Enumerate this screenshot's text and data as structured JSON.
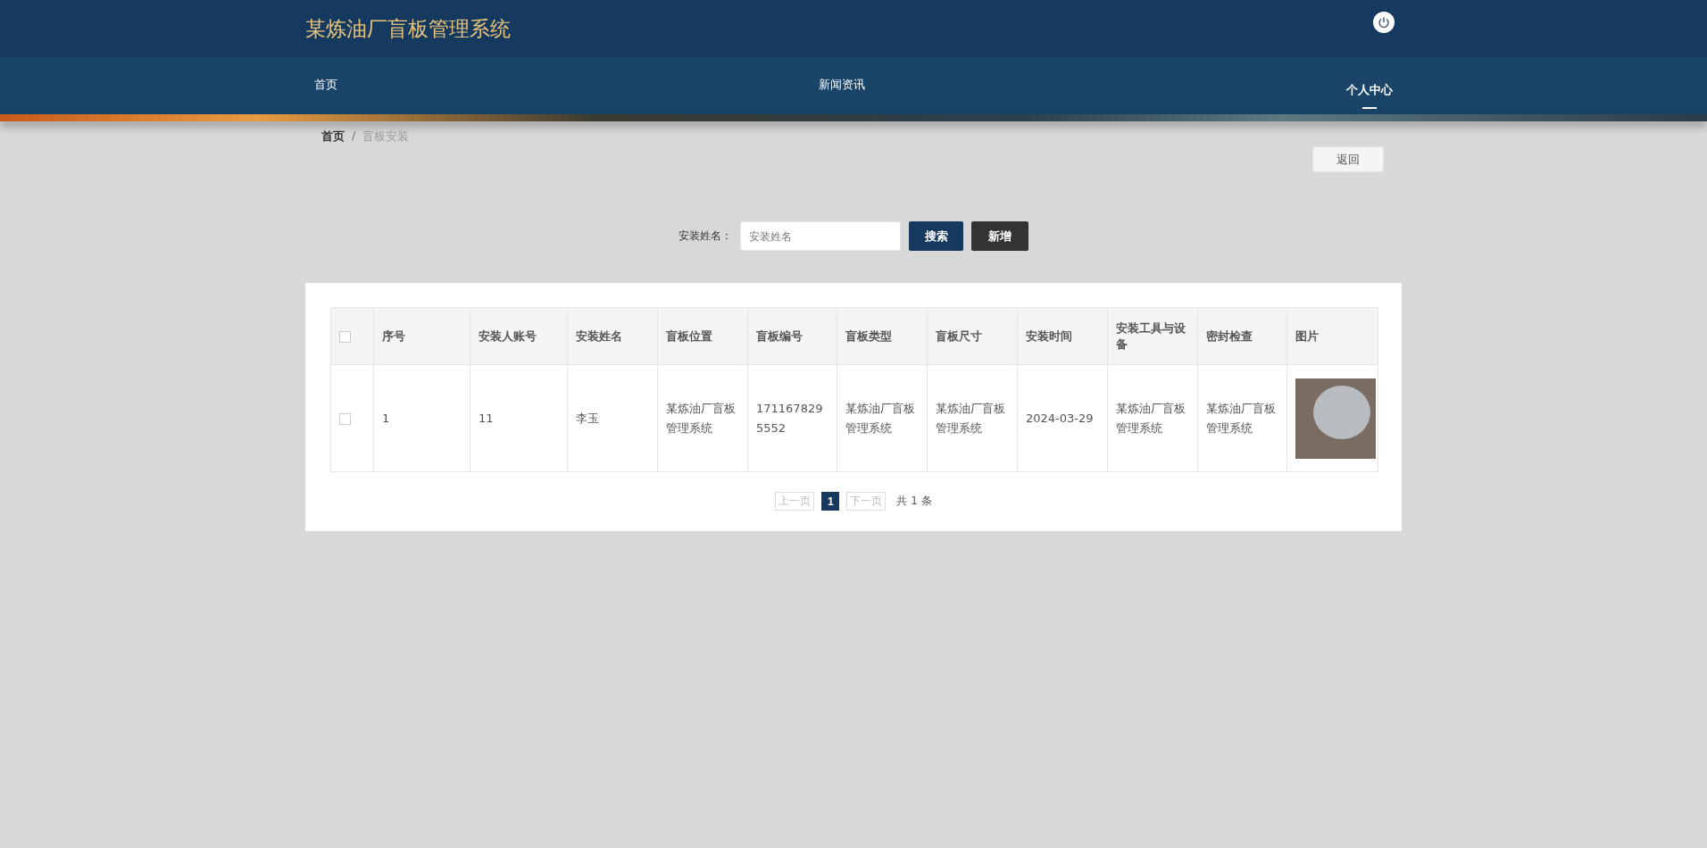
{
  "header": {
    "title": "某炼油厂盲板管理系统"
  },
  "nav": [
    {
      "label": "首页",
      "selected": false
    },
    {
      "label": "新闻资讯",
      "selected": false
    },
    {
      "label": "个人中心",
      "selected": true
    }
  ],
  "breadcrumb": [
    {
      "label": "首页",
      "current": false
    },
    {
      "label": "盲板安装",
      "current": true
    }
  ],
  "breadcrumb_separator": "/",
  "back_button": "返回",
  "search": {
    "label": "安装姓名：",
    "placeholder": "安装姓名",
    "search_button": "搜索",
    "add_button": "新增"
  },
  "table": {
    "select_all": {
      "checked": false
    },
    "columns": [
      "序号",
      "安装人账号",
      "安装姓名",
      "盲板位置",
      "盲板编号",
      "盲板类型",
      "盲板尺寸",
      "安装时间",
      "安装工具与设备",
      "密封检查",
      "图片"
    ],
    "rows": [
      {
        "checked": false,
        "cells": [
          "1",
          "11",
          "李玉",
          "某炼油厂盲板管理系统",
          "1711678295552",
          "某炼油厂盲板管理系统",
          "某炼油厂盲板管理系统",
          "2024-03-29",
          "某炼油厂盲板管理系统",
          "某炼油厂盲板管理系统"
        ]
      }
    ]
  },
  "pagination": {
    "prev": {
      "label": "上一页",
      "disabled": true
    },
    "pages": [
      {
        "label": "1",
        "selected": true
      }
    ],
    "next": {
      "label": "下一页",
      "disabled": true
    },
    "total": "共 1 条"
  }
}
